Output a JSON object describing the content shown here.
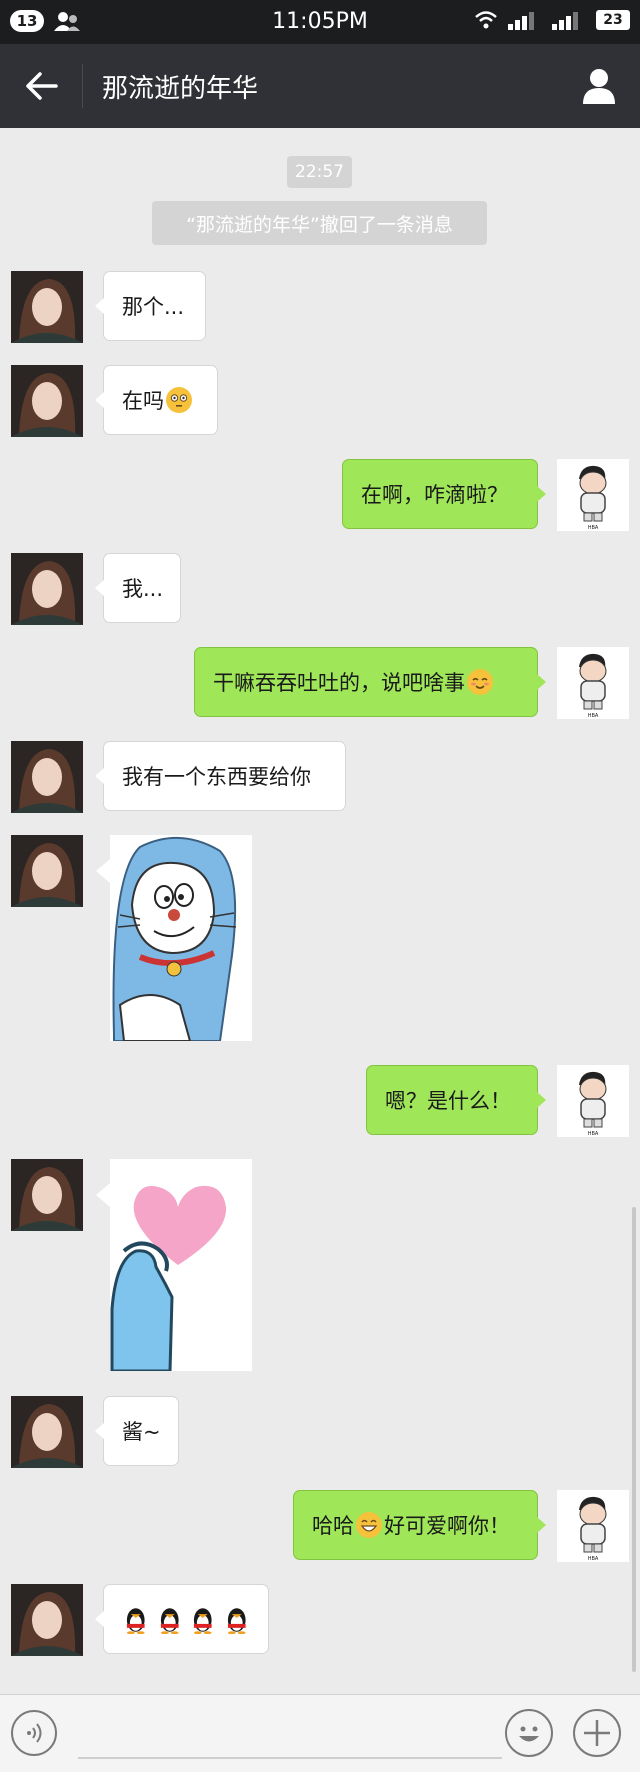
{
  "status_bar": {
    "notification_count": "13",
    "time": "11:05PM",
    "battery": "23"
  },
  "header": {
    "title": "那流逝的年华"
  },
  "chat": {
    "timestamp": "22:57",
    "system_notice": "“那流逝的年华”撤回了一条消息",
    "messages": [
      {
        "text": "那个..."
      },
      {
        "text": "在吗"
      },
      {
        "text": "在啊，咋滴啦？"
      },
      {
        "text": "我..."
      },
      {
        "text": "干嘛吞吞吐吐的，说吧啥事"
      },
      {
        "text": "我有一个东西要给你"
      },
      {
        "text": "嗯？是什么！"
      },
      {
        "text": "酱~"
      },
      {
        "text_before": "哈哈",
        "text_after": "好可爱啊你！"
      }
    ],
    "avatar_caption": "HBA"
  },
  "colors": {
    "status_bar_bg": "#1c1d1f",
    "header_bg": "#2f3136",
    "chat_bg": "#ebebeb",
    "outgoing_bubble": "#9fe658",
    "incoming_bubble": "#ffffff"
  },
  "icons": [
    "back-arrow-icon",
    "profile-icon",
    "voice-icon",
    "emoji-icon",
    "plus-icon",
    "wifi-icon",
    "signal-icon",
    "contacts-icon"
  ]
}
